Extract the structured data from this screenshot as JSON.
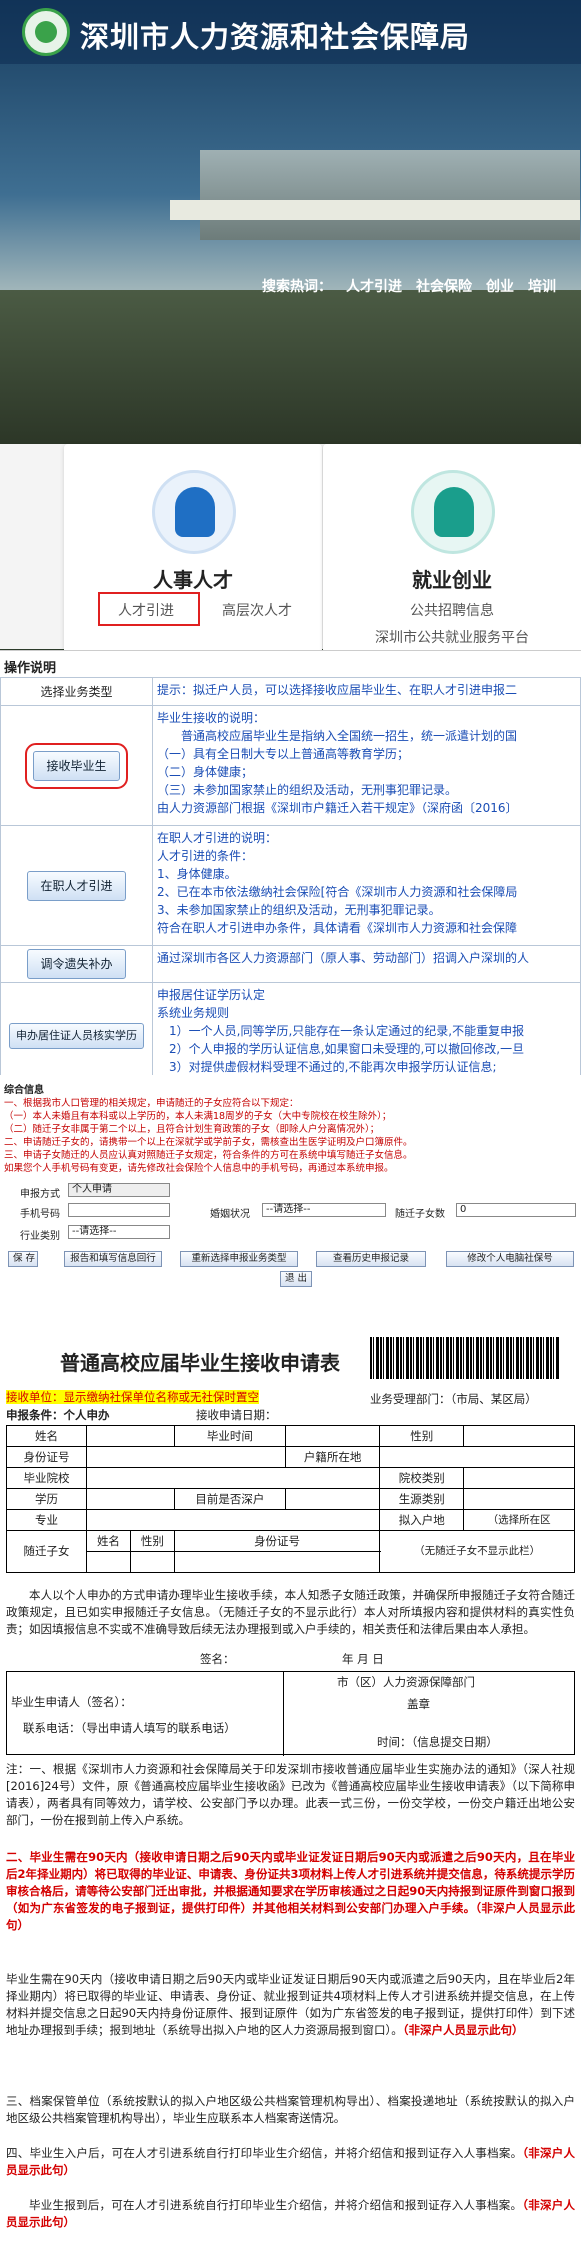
{
  "header": {
    "site_title": "深圳市人力资源和社会保障局"
  },
  "search": {
    "hot_label": "搜索热词：",
    "hot_words": [
      "人才引进",
      "社会保险",
      "创业",
      "培训"
    ]
  },
  "cards": [
    {
      "title": "人事人才",
      "links": [
        "人才引进",
        "高层次人才"
      ]
    },
    {
      "title": "就业创业",
      "links": [
        "公共招聘信息",
        "深圳市公共就业服务平台"
      ]
    }
  ],
  "ops": {
    "heading": "操作说明",
    "rows": [
      {
        "left": "选择业务类型",
        "right": [
          "提示：拟迁户人员，可以选择接收应届毕业生、在职人才引进申报二"
        ]
      },
      {
        "left": "接收毕业生",
        "right": [
          "毕业生接收的说明：",
          "普通高校应届毕业生是指纳入全国统一招生，统一派遣计划的国",
          "（一）具有全日制大专以上普通高等教育学历；",
          "（二）身体健康；",
          "（三）未参加国家禁止的组织及活动，无刑事犯罪记录。",
          "由人力资源部门根据《深圳市户籍迁入若干规定》（深府函〔2016〕"
        ]
      },
      {
        "left": "在职人才引进",
        "right": [
          "在职人才引进的说明：",
          "人才引进的条件：",
          "1、身体健康。",
          "2、已在本市依法缴纳社会保险[符合《深圳市人力资源和社会保障局",
          "3、未参加国家禁止的组织及活动，无刑事犯罪记录。",
          "符合在职人才引进申办条件，具体请看《深圳市人力资源和社会保障"
        ]
      },
      {
        "left": "调令遗失补办",
        "right": [
          "通过深圳市各区人力资源部门（原人事、劳动部门）招调入户深圳的人"
        ]
      },
      {
        "left": "申办居住证人员核实学历",
        "right": [
          "申报居住证学历认定",
          "系统业务规则",
          "1）一个人员,同等学历,只能存在一条认定通过的纪录,不能重复申报",
          "2）个人申报的学历认证信息,如果窗口未受理的,可以撤回修改,一旦",
          "3）对提供虚假材料受理不通过的,不能再次申报学历认证信息;",
          "4）个人提交申报后,需要打印相应的申报表,申报业务办法请通过（辩解"
        ]
      }
    ]
  },
  "form": {
    "section_title": "综合信息",
    "notes": [
      "一、根据我市人口管理的相关规定，申请随迁的子女应符合以下规定：",
      "（一）本人未婚且有本科或以上学历的，本人未满18周岁的子女（大中专院校在校生除外）；",
      "（二）随迁子女非属于第二个以上，且符合计划生育政策的子女（即除人户分离情况外）；",
      "二、申请随迁子女的，请携带一个以上在深就学或学前子女，需核查出生医学证明及户口簿原件。",
      "三、申请子女随迁的人员应认真对照随迁子女规定，符合条件的方可在系统中填写随迁子女信息。",
      "如果您个人手机号码有变更，请先修改社会保险个人信息中的手机号码，再通过本系统申报。"
    ],
    "fields": [
      {
        "label": "申报方式",
        "value": "个人申请"
      },
      {
        "label": "手机号码",
        "value": ""
      },
      {
        "label": "婚姻状况",
        "value": "--请选择--"
      },
      {
        "label": "随迁子女数",
        "value": "0"
      },
      {
        "label": "行业类别",
        "value": "--请选择--"
      }
    ],
    "buttons": [
      "保 存",
      "报告和填写信息回行",
      "重新选择申报业务类型",
      "查看历史申报记录",
      "修改个人电脑社保号",
      "退 出"
    ]
  },
  "doc": {
    "title": "普通高校应届毕业生接收申请表",
    "unit_label": "接收单位：显示缴纳社保单位名称或无社保时置空",
    "dept": "业务受理部门：（市局、某区局）",
    "cond": "申报条件：个人申办",
    "date": "接收申请日期：",
    "rows": [
      [
        "姓名",
        "",
        "毕业时间",
        "",
        "性别",
        ""
      ],
      [
        "身份证号",
        "",
        "",
        "户籍所在地",
        "",
        ""
      ],
      [
        "毕业院校",
        "",
        "",
        "",
        "院校类别",
        ""
      ],
      [
        "学历",
        "",
        "目前是否深户",
        "",
        "生源类别",
        ""
      ],
      [
        "专业",
        "",
        "",
        "",
        "拟入户地",
        "（选择所在区"
      ]
    ],
    "child_head": [
      "随迁子女",
      "姓名",
      "性别",
      "身份证号",
      "（无随迁子女不显示此栏）"
    ],
    "pledge": "本人以个人申办的方式申请办理毕业生接收手续，本人知悉子女随迁政策，并确保所申报随迁子女符合随迁政策规定，且已如实申报随迁子女信息。（无随迁子女的不显示此行）本人对所填报内容和提供材料的真实性负责；如因填报信息不实或不准确导致后续无法办理报到或入户手续的，相关责任和法律后果由本人承担。",
    "sign": "签名：",
    "ymd": "年      月      日",
    "applicant": "毕业生申请人（签名）：",
    "phone": "联系电话：（导出申请人填写的联系电话）",
    "bureau": "市（区）人力资源保障部门",
    "stamp": "盖章",
    "time": "时间：（信息提交日期）",
    "notes": [
      "注：一、根据《深圳市人力资源和社会保障局关于印发深圳市接收普通应届毕业生实施办法的通知》（深人社规[2016]24号）文件，原《普通高校应届毕业生接收函》已改为《普通高校应届毕业生接收申请表》（以下简称申请表），两者具有同等效力，请学校、公安部门予以办理。此表一式三份，一份交学校，一份交户籍迁出地公安部门，一份在报到前上传入户系统。",
      "二、毕业生需在90天内（接收申请日期之后90天内或毕业证发证日期后90天内或派遣之后90天内，且在毕业后2年择业期内）将已取得的毕业证、申请表、身份证共3项材料上传人才引进系统并提交信息，待系统提示学历审核合格后，请等待公安部门迁出审批，并根据通知要求在学历审核通过之日起90天内持报到证原件到窗口报到（如为广东省签发的电子报到证，提供打印件）并其他相关材料到公安部门办理入户手续。",
      "毕业生需在90天内（接收申请日期之后90天内或毕业证发证日期后90天内或派遣之后90天内，且在毕业后2年择业期内）将已取得的毕业证、申请表、身份证、就业报到证共4项材料上传人才引进系统并提交信息，在上传材料并提交信息之日起90天内持身份证原件、报到证原件（如为广东省签发的电子报到证，提供打印件）到下述地址办理报到手续；报到地址（系统导出拟入户地的区人力资源局报到窗口）。",
      "三、档案保管单位（系统按默认的拟入户地区级公共档案管理机构导出）、档案投递地址（系统按默认的拟入户地区级公共档案管理机构导出），毕业生应联系本人档案寄送情况。",
      "四、毕业生入户后，可在人才引进系统自行打印毕业生介绍信，并将介绍信和报到证存入人事档案。",
      "毕业生报到后，可在人才引进系统自行打印毕业生介绍信，并将介绍信和报到证存入人事档案。"
    ],
    "red_tag": "（非深户人员显示此句）"
  }
}
